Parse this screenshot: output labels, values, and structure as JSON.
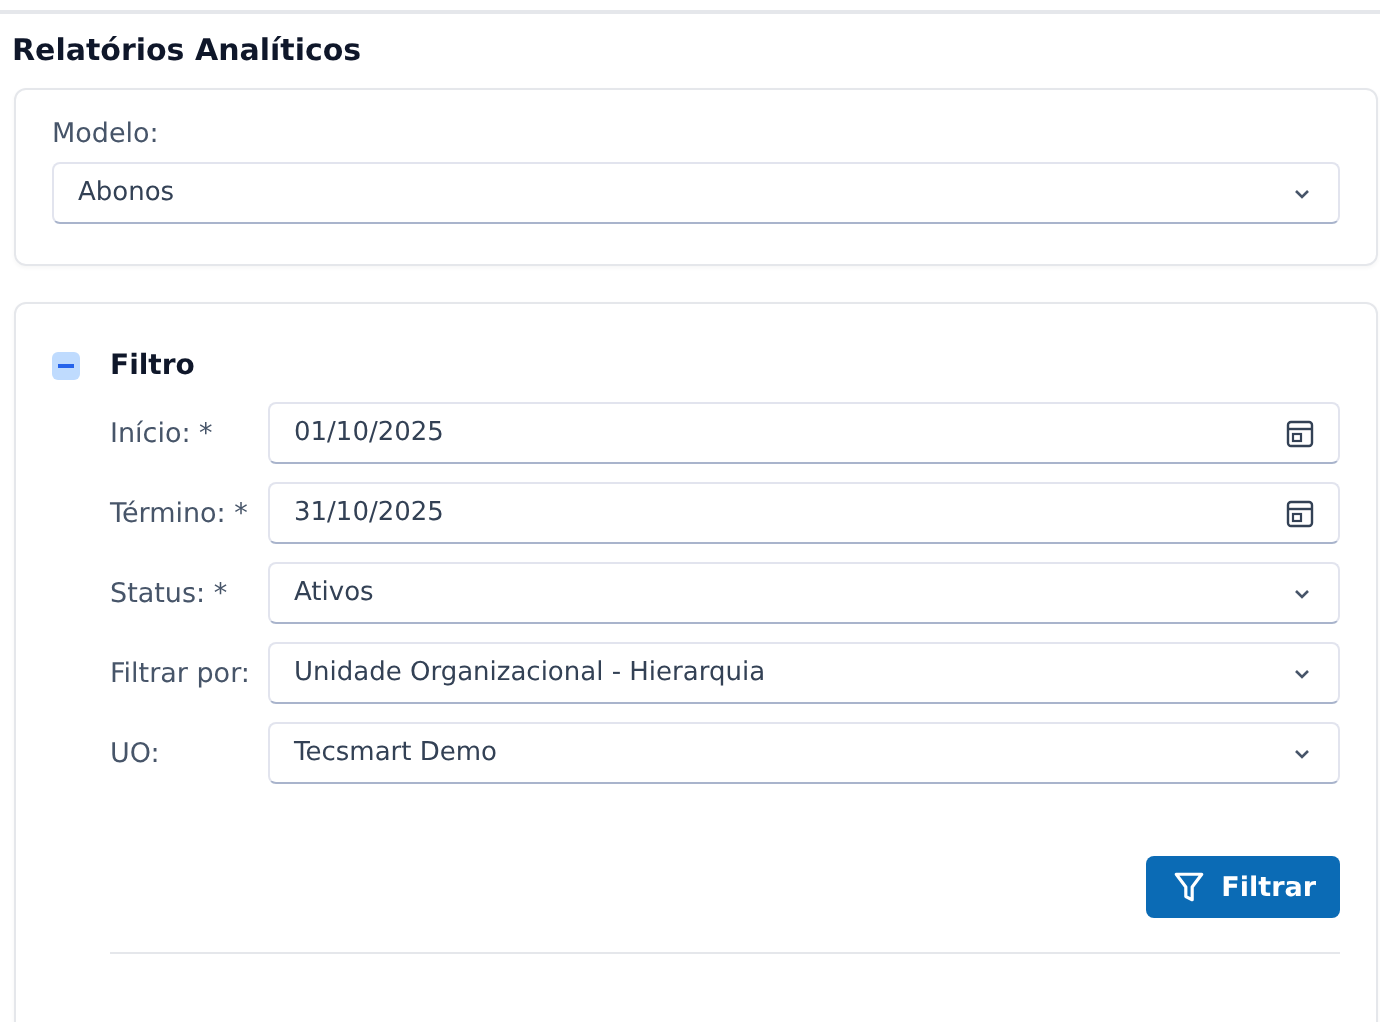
{
  "title": "Relatórios Analíticos",
  "model": {
    "label": "Modelo:",
    "value": "Abonos"
  },
  "filter": {
    "title": "Filtro",
    "expanded": true,
    "fields": [
      {
        "label": "Início: *",
        "value": "01/10/2025",
        "kind": "date"
      },
      {
        "label": "Término: *",
        "value": "31/10/2025",
        "kind": "date"
      },
      {
        "label": "Status: *",
        "value": "Ativos",
        "kind": "select"
      },
      {
        "label": "Filtrar por:",
        "value": "Unidade Organizacional - Hierarquia",
        "kind": "select"
      },
      {
        "label": "UO:",
        "value": "Tecsmart Demo",
        "kind": "select"
      }
    ],
    "button": "Filtrar"
  }
}
